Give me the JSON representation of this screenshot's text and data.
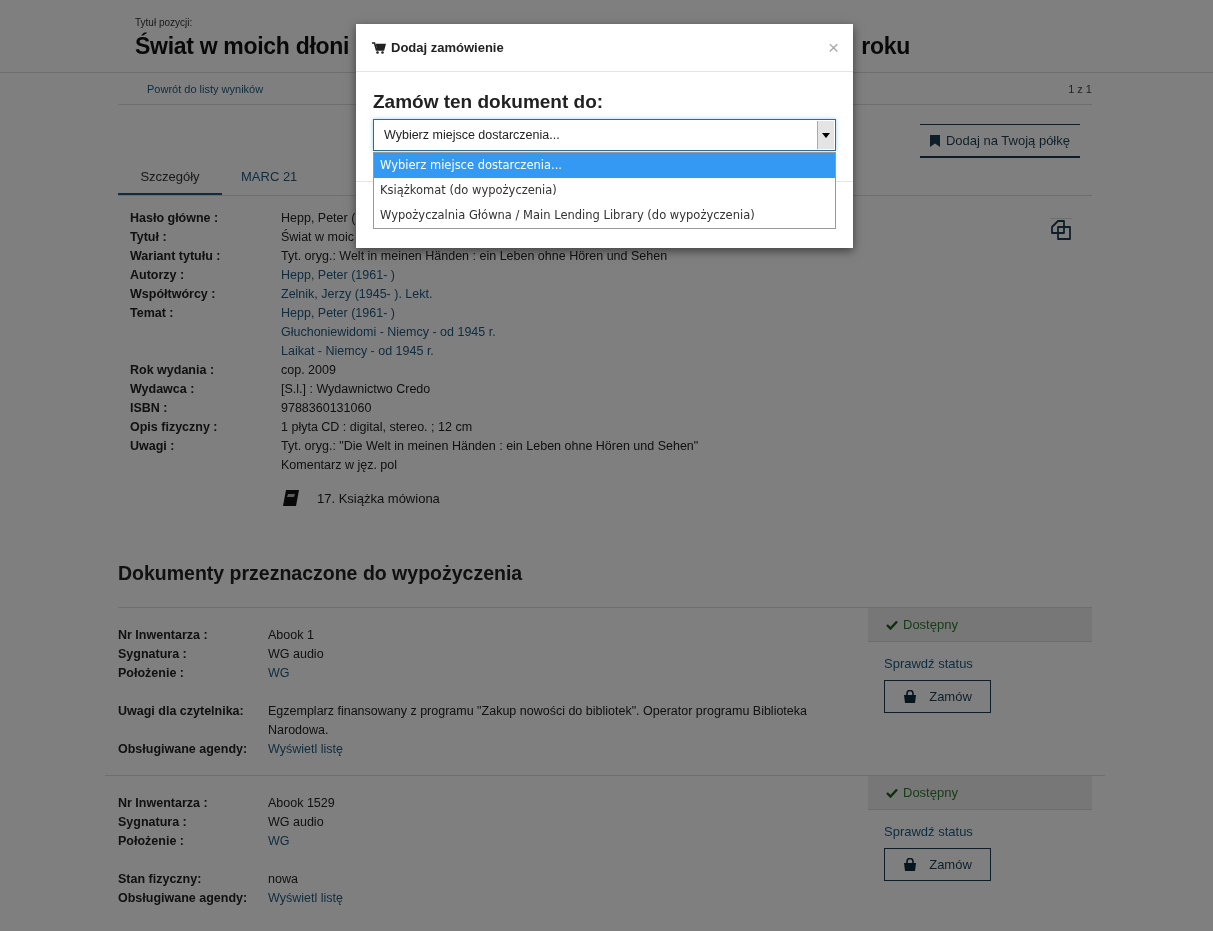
{
  "page": {
    "title_label": "Tytuł pozycji:",
    "title_parts": [
      "Świat w moich dłoni",
      "roku"
    ],
    "back_link": "Powrót do listy wyników",
    "pager": "1 z 1",
    "shelf_button": "Dodaj na Twoją półkę",
    "tabs": [
      {
        "label": "Szczegóły",
        "selected": true
      },
      {
        "label": "MARC 21",
        "selected": false
      }
    ],
    "details": [
      {
        "label": "Hasło główne :",
        "values": [
          {
            "text": "Hepp, Peter (",
            "link": false
          }
        ]
      },
      {
        "label": "Tytuł :",
        "values": [
          {
            "text": "Świat w moic",
            "link": false
          }
        ]
      },
      {
        "label": "Wariant tytułu :",
        "values": [
          {
            "text": "Tyt. oryg.: Welt in meinen Händen : ein Leben ohne Hören und Sehen",
            "link": false
          }
        ]
      },
      {
        "label": "Autorzy :",
        "values": [
          {
            "text": "Hepp, Peter (1961- )",
            "link": true
          }
        ]
      },
      {
        "label": "Współtwórcy :",
        "values": [
          {
            "text": "Zelnik, Jerzy (1945- ). Lekt.",
            "link": true
          }
        ]
      },
      {
        "label": "Temat :",
        "values": [
          {
            "text": "Hepp, Peter (1961- )",
            "link": true
          },
          {
            "text": "Głuchoniewidomi - Niemcy - od 1945 r.",
            "link": true
          },
          {
            "text": "Laikat - Niemcy - od 1945 r.",
            "link": true
          }
        ]
      },
      {
        "label": "Rok wydania :",
        "values": [
          {
            "text": "cop. 2009",
            "link": false
          }
        ]
      },
      {
        "label": "Wydawca :",
        "values": [
          {
            "text": "[S.l.] : Wydawnictwo Credo",
            "link": false
          }
        ]
      },
      {
        "label": "ISBN :",
        "values": [
          {
            "text": "9788360131060",
            "link": false
          }
        ]
      },
      {
        "label": "Opis fizyczny :",
        "values": [
          {
            "text": "1 płyta CD : digital, stereo. ; 12 cm",
            "link": false
          }
        ]
      },
      {
        "label": "Uwagi :",
        "values": [
          {
            "text": "Tyt. oryg.: \"Die Welt in meinen Händen : ein Leben ohne Hören und Sehen\"",
            "link": false
          },
          {
            "text": "Komentarz w jęz. pol",
            "link": false
          }
        ]
      }
    ],
    "format": "17. Książka mówiona",
    "copies_heading": "Dokumenty przeznaczone do wypożyczenia",
    "copies": [
      {
        "groups": [
          [
            {
              "label": "Nr Inwentarza :",
              "value": "Abook 1",
              "link": false
            },
            {
              "label": "Sygnatura :",
              "value": "WG audio",
              "link": false
            },
            {
              "label": "Położenie :",
              "value": "WG",
              "link": true
            }
          ],
          [
            {
              "label": "Uwagi dla czytelnika:",
              "value": "Egzemplarz finansowany z programu \"Zakup nowości do bibliotek\". Operator programu Biblioteka Narodowa.",
              "link": false
            },
            {
              "label": "Obsługiwane agendy:",
              "value": "Wyświetl listę",
              "link": true
            }
          ]
        ],
        "status": "Dostępny",
        "check_status": "Sprawdź status",
        "order_button": "Zamów"
      },
      {
        "groups": [
          [
            {
              "label": "Nr Inwentarza :",
              "value": "Abook 1529",
              "link": false
            },
            {
              "label": "Sygnatura :",
              "value": "WG audio",
              "link": false
            },
            {
              "label": "Położenie :",
              "value": "WG",
              "link": true
            }
          ],
          [
            {
              "label": "Stan fizyczny:",
              "value": "nowa",
              "link": false
            },
            {
              "label": "Obsługiwane agendy:",
              "value": "Wyświetl listę",
              "link": true
            }
          ]
        ],
        "status": "Dostępny",
        "check_status": "Sprawdź status",
        "order_button": "Zamów"
      }
    ]
  },
  "modal": {
    "title": "Dodaj zamówienie",
    "close": "×",
    "prompt": "Zamów ten dokument do:",
    "select": {
      "value": "Wybierz miejsce dostarczenia...",
      "expanded": true,
      "options": [
        {
          "label": "Wybierz miejsce dostarczenia...",
          "selected": true
        },
        {
          "label": "Książkomat (do wypożyczenia)",
          "selected": false
        },
        {
          "label": "Wypożyczalnia Główna / Main Lending Library (do wypożyczenia)",
          "selected": false
        }
      ]
    }
  }
}
